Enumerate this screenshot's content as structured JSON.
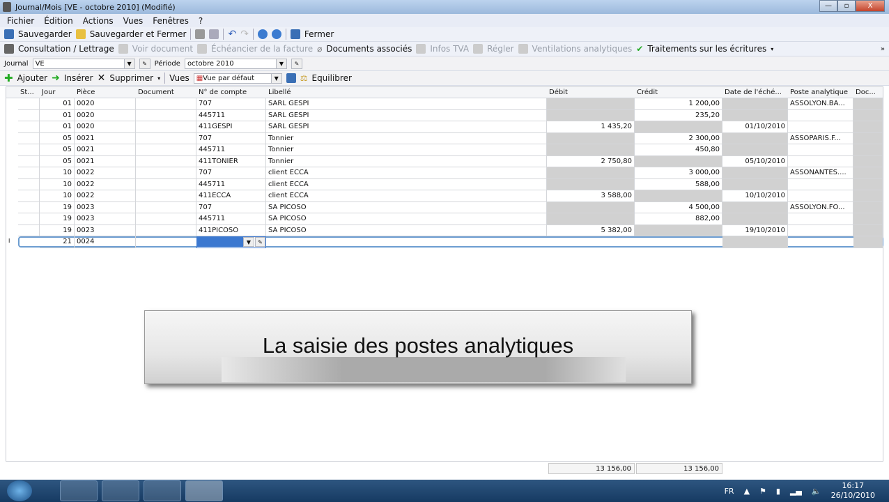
{
  "window": {
    "title": "Journal/Mois [VE - octobre 2010] (Modifié)",
    "min": "—",
    "max": "▫",
    "close": "X"
  },
  "menu": [
    "Fichier",
    "Édition",
    "Actions",
    "Vues",
    "Fenêtres",
    "?"
  ],
  "toolbar1": {
    "save": "Sauvegarder",
    "save_close": "Sauvegarder et Fermer",
    "close": "Fermer"
  },
  "toolbar2": {
    "consultation": "Consultation / Lettrage",
    "voir": "Voir document",
    "echeancier": "Échéancier de la facture",
    "docs": "Documents associés",
    "tva": "Infos TVA",
    "regler": "Régler",
    "ventilations": "Ventilations analytiques",
    "traitements": "Traitements sur les écritures",
    "more": "»"
  },
  "filters": {
    "journal_label": "Journal",
    "journal_value": "VE",
    "periode_label": "Période",
    "periode_value": "octobre 2010"
  },
  "toolbar4": {
    "ajouter": "Ajouter",
    "inserer": "Insérer",
    "supprimer": "Supprimer",
    "vues": "Vues",
    "vue_value": "Vue par défaut",
    "equilibrer": "Equilibrer"
  },
  "columns": [
    "St...",
    "Jour",
    "Pièce",
    "Document",
    "N° de compte",
    "Libellé",
    "Débit",
    "Crédit",
    "Date de l'éché...",
    "Poste analytique",
    "Doc..."
  ],
  "rows": [
    [
      "01",
      "0020",
      "707",
      "SARL GESPI",
      "",
      "1 200,00",
      "",
      "ASSOLYON.BA..."
    ],
    [
      "01",
      "0020",
      "445711",
      "SARL GESPI",
      "",
      "235,20",
      "",
      ""
    ],
    [
      "01",
      "0020",
      "411GESPI",
      "SARL GESPI",
      "1 435,20",
      "",
      "01/10/2010",
      ""
    ],
    [
      "05",
      "0021",
      "707",
      "Tonnier",
      "",
      "2 300,00",
      "",
      "ASSOPARIS.F..."
    ],
    [
      "05",
      "0021",
      "445711",
      "Tonnier",
      "",
      "450,80",
      "",
      ""
    ],
    [
      "05",
      "0021",
      "411TONIER",
      "Tonnier",
      "2 750,80",
      "",
      "05/10/2010",
      ""
    ],
    [
      "10",
      "0022",
      "707",
      "client ECCA",
      "",
      "3 000,00",
      "",
      "ASSONANTES...."
    ],
    [
      "10",
      "0022",
      "445711",
      "client ECCA",
      "",
      "588,00",
      "",
      ""
    ],
    [
      "10",
      "0022",
      "411ECCA",
      "client ECCA",
      "3 588,00",
      "",
      "10/10/2010",
      ""
    ],
    [
      "19",
      "0023",
      "707",
      "SA PICOSO",
      "",
      "4 500,00",
      "",
      "ASSOLYON.FO..."
    ],
    [
      "19",
      "0023",
      "445711",
      "SA PICOSO",
      "",
      "882,00",
      "",
      ""
    ],
    [
      "19",
      "0023",
      "411PICOSO",
      "SA PICOSO",
      "5 382,00",
      "",
      "19/10/2010",
      ""
    ]
  ],
  "new_row": {
    "marker": "I",
    "jour": "21",
    "piece": "0024"
  },
  "banner": "La saisie des postes analytiques",
  "totals": {
    "debit": "13 156,00",
    "credit": "13 156,00"
  },
  "tray": {
    "lang": "FR",
    "time": "16:17",
    "date": "26/10/2010"
  }
}
